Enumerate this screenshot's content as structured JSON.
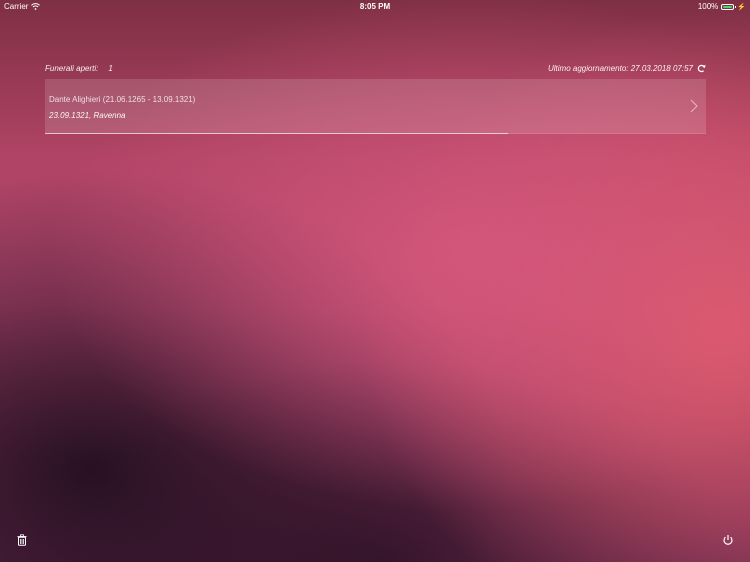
{
  "status_bar": {
    "carrier": "Carrier",
    "time": "8:05 PM",
    "battery": "100%",
    "battery_level": 1.0,
    "battery_color": "#4cd964",
    "icons": [
      "wifi-icon",
      "battery-icon",
      "bolt-icon"
    ]
  },
  "header": {
    "open_label": "Funerali aperti:",
    "open_count": "1",
    "last_update_label": "Ultimo aggiornamento: 27.03.2018 07:57",
    "refresh_icon": "refresh-icon"
  },
  "funerals": [
    {
      "title": "Dante Alighieri (21.06.1265 - 13.09.1321)",
      "subtitle": "23.09.1321, Ravenna",
      "progress": 0.7
    }
  ],
  "footer": {
    "left_icon": "trash-icon",
    "right_icon": "power-icon"
  }
}
